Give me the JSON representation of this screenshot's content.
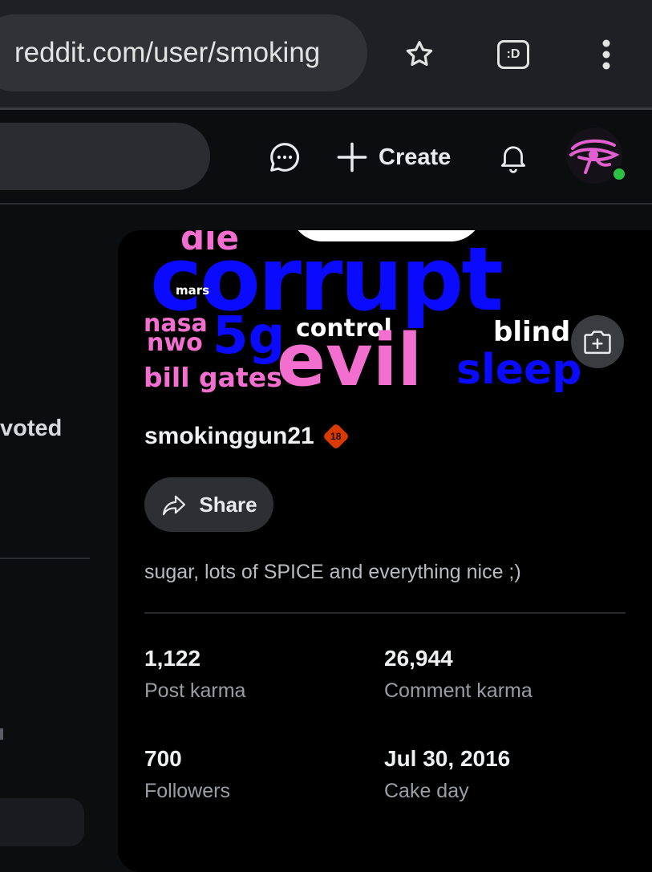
{
  "browser": {
    "url": "reddit.com/user/smoking",
    "extension_label": ":D",
    "icons": [
      "star-icon",
      "extension-icon",
      "more-vert-icon"
    ]
  },
  "header": {
    "create_label": "Create",
    "icons": [
      "chat-icon",
      "plus-icon",
      "bell-icon",
      "avatar"
    ]
  },
  "sidebar": {
    "partial_label": "voted"
  },
  "banner": {
    "words": [
      "die",
      "corrupt",
      "mars",
      "nasa",
      "nwo",
      "5g",
      "control",
      "blind",
      "bill gates",
      "evil",
      "sleep"
    ],
    "colors": {
      "blue": "#0a0aff",
      "pink": "#f36fcf",
      "white": "#ffffff"
    }
  },
  "profile": {
    "username": "smokinggun21",
    "nsfw_badge": "18",
    "share_label": "Share",
    "bio": "sugar, lots of SPICE and everything nice ;)",
    "stats": [
      {
        "value": "1,122",
        "label": "Post karma"
      },
      {
        "value": "26,944",
        "label": "Comment karma"
      },
      {
        "value": "700",
        "label": "Followers"
      },
      {
        "value": "Jul 30, 2016",
        "label": "Cake day"
      }
    ]
  },
  "colors": {
    "background": "#0c0d0f",
    "card": "#000000",
    "badge": "#d93a00",
    "online": "#2bc145"
  }
}
